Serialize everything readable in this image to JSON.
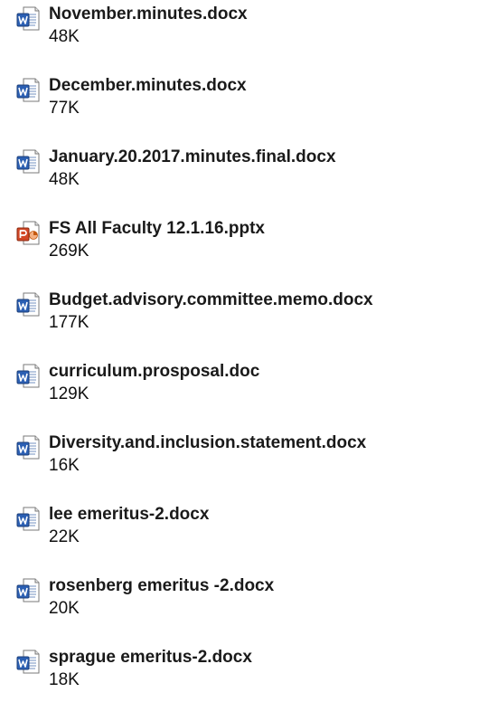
{
  "colors": {
    "word_icon": "#2b5fb3",
    "ppt_icon": "#d24726"
  },
  "files": [
    {
      "name": "November.minutes.docx",
      "size": "48K",
      "icon": "word-doc-icon"
    },
    {
      "name": "December.minutes.docx",
      "size": "77K",
      "icon": "word-doc-icon"
    },
    {
      "name": "January.20.2017.minutes.final.docx",
      "size": "48K",
      "icon": "word-doc-icon"
    },
    {
      "name": "FS All Faculty 12.1.16.pptx",
      "size": "269K",
      "icon": "powerpoint-icon"
    },
    {
      "name": "Budget.advisory.committee.memo.docx",
      "size": "177K",
      "icon": "word-doc-icon"
    },
    {
      "name": "curriculum.prosposal.doc",
      "size": "129K",
      "icon": "word-doc-icon"
    },
    {
      "name": "Diversity.and.inclusion.statement.docx",
      "size": "16K",
      "icon": "word-doc-icon"
    },
    {
      "name": "lee emeritus-2.docx",
      "size": "22K",
      "icon": "word-doc-icon"
    },
    {
      "name": "rosenberg emeritus -2.docx",
      "size": "20K",
      "icon": "word-doc-icon"
    },
    {
      "name": "sprague emeritus-2.docx",
      "size": "18K",
      "icon": "word-doc-icon"
    }
  ]
}
